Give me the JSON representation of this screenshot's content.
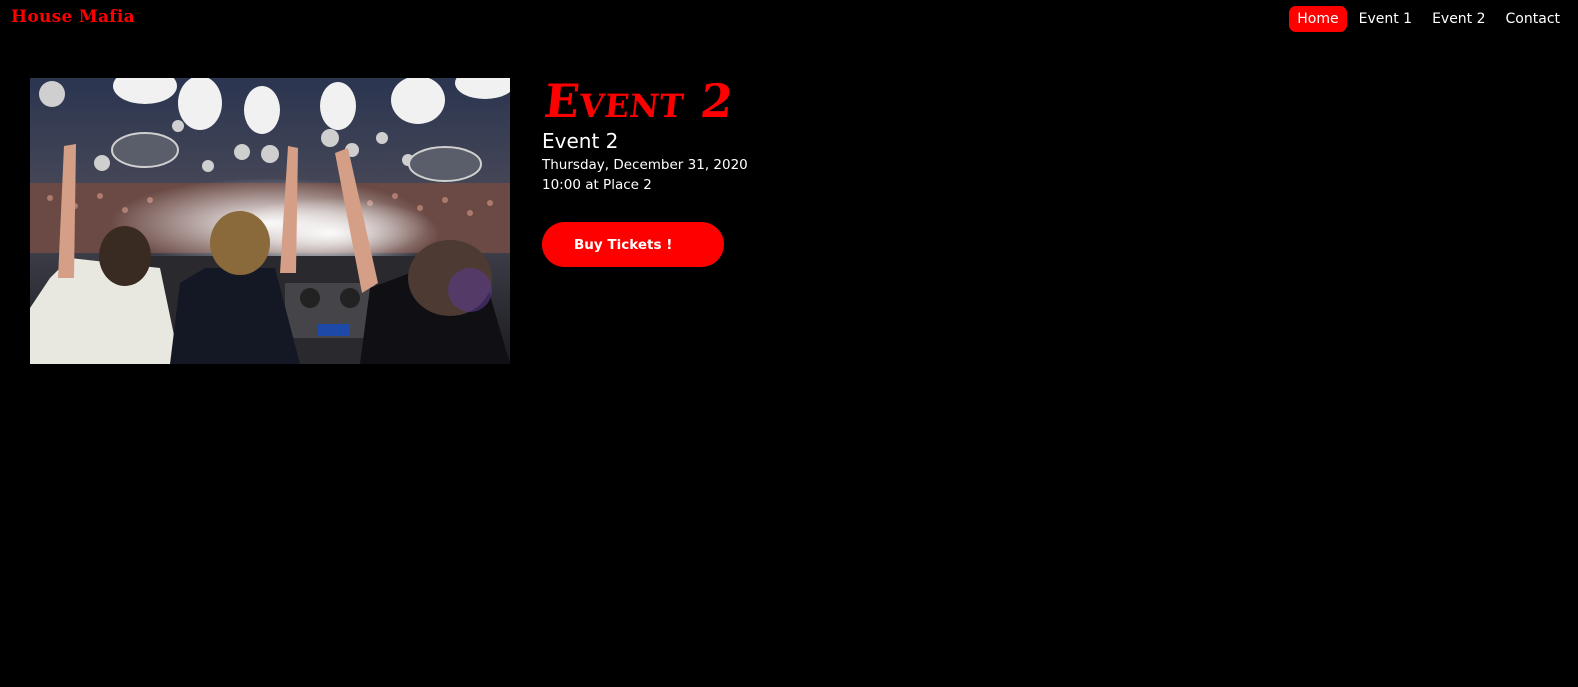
{
  "nav": {
    "brand": "House Mafia",
    "links": [
      {
        "label": "Home",
        "active": true
      },
      {
        "label": "Event 1",
        "active": false
      },
      {
        "label": "Event 2",
        "active": false
      },
      {
        "label": "Contact",
        "active": false
      }
    ]
  },
  "event": {
    "heading": "Event 2",
    "name": "Event 2",
    "date": "Thursday, December 31, 2020",
    "time_place": "10:00 at Place 2",
    "buy_label": "Buy Tickets !",
    "image_alt": "DJs performing on stage in front of a crowd"
  },
  "colors": {
    "accent": "#ff0000",
    "background": "#000000",
    "text": "#ffffff"
  }
}
